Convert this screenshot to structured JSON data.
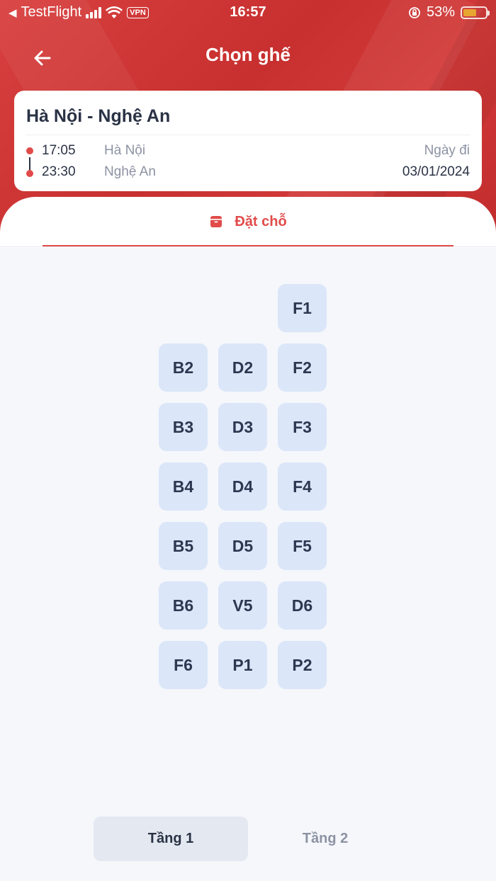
{
  "status_bar": {
    "back_app": "TestFlight",
    "vpn": "VPN",
    "time": "16:57",
    "battery": "53%",
    "battery_level": 0.53,
    "battery_color": "#e8a531"
  },
  "nav": {
    "title": "Chọn ghế",
    "back_icon": "arrow-left-icon"
  },
  "trip": {
    "route": "Hà Nội - Nghệ An",
    "depart_time": "17:05",
    "depart_place": "Hà Nội",
    "arrive_time": "23:30",
    "arrive_place": "Nghệ An",
    "date_label": "Ngày đi",
    "date_value": "03/01/2024"
  },
  "tab": {
    "label": "Đặt chỗ",
    "icon": "archive-box-icon",
    "accent": "#e14b4a"
  },
  "seats": [
    "F1",
    "B2",
    "D2",
    "F2",
    "B3",
    "D3",
    "F3",
    "B4",
    "D4",
    "F4",
    "B5",
    "D5",
    "F5",
    "B6",
    "V5",
    "D6",
    "F6",
    "P1",
    "P2"
  ],
  "floors": {
    "floor1": "Tầng 1",
    "floor2": "Tầng 2",
    "selected": "Tầng 1"
  },
  "colors": {
    "header": "#d03a39",
    "seat_bg": "#dbe6f9",
    "background": "#f5f7fb"
  }
}
